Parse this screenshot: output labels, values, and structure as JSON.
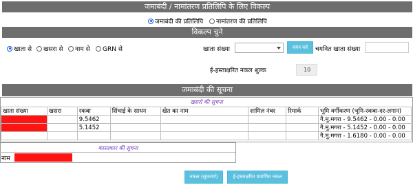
{
  "sections": {
    "options_title": "जमाबंदी / नामांतरण प्रतिलिपि के लिए विकल्प",
    "choose_title": "विकल्प चुने",
    "info_title": "जमाबंदी की सूचना"
  },
  "copy_type": {
    "options": [
      "जमाबंदी की प्रतिलिपि",
      "नामांतरण की प्रतिलिपि"
    ],
    "selected": 0
  },
  "search_by": {
    "options": [
      "खाता से",
      "खसरा से",
      "नाम से",
      "GRN से"
    ],
    "selected": 0
  },
  "form": {
    "khata_label": "खाता संख्या",
    "select_button": "चयन करे",
    "selected_khata_label": "चयनित खाता संख्या",
    "fee_label": "ई-हस्ताक्षरित नकल शुल्क",
    "fee_value": "10"
  },
  "khasra_table": {
    "caption": "खसरो की सूचना",
    "headers": [
      "खाता संख्या",
      "खसरा",
      "रकबा",
      "सिंचाई के साधन",
      "खेत का नाम",
      "शामिल नंबर",
      "रिमार्क",
      "भूमि वर्गीकरण (भूमि-रकबा-दर-लगान)"
    ],
    "rows": [
      {
        "raqba": "9.5462",
        "bhumi": "गै.मु.मगरा - 9.5462 - 0.00 - 0.00"
      },
      {
        "raqba": "5.1452",
        "bhumi": "गै.मु.मगरा - 5.1452 - 0.00 - 0.00"
      },
      {
        "raqba": "",
        "bhumi": "गै.मु.मगरा - 1.6180 - 0.00 - 0.00"
      }
    ]
  },
  "owner": {
    "caption": "कास्तकार की सूचना",
    "name_label": "नाम"
  },
  "actions": {
    "copy_button": "नकल (सूचनार्थ)",
    "esign_button": "ई-हस्ताक्षरित प्रमाणित नकल"
  },
  "colors": {
    "header_bar": "#6e6e6e",
    "button": "#5bc0de",
    "redacted": "#ff1414",
    "caption": "#7a3fbf"
  }
}
